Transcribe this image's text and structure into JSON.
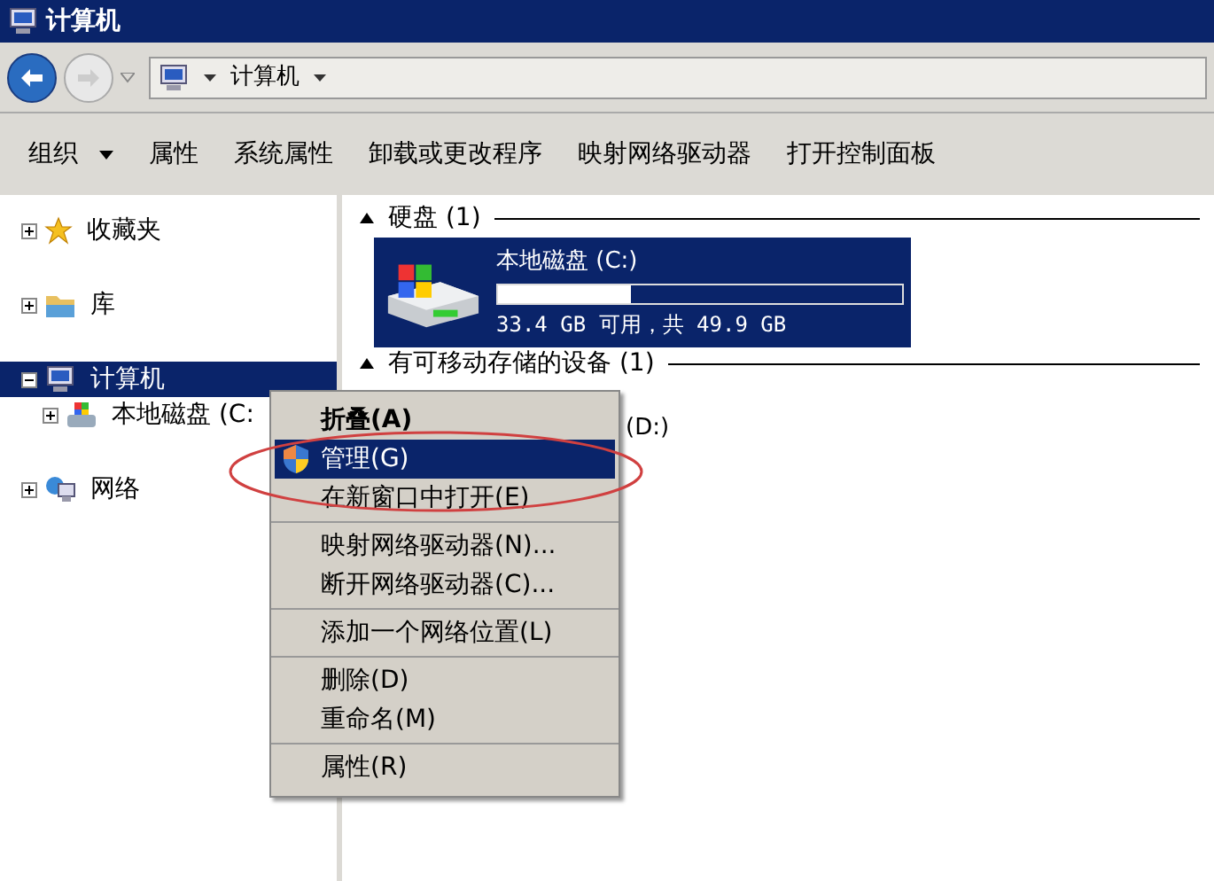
{
  "window": {
    "title": "计算机"
  },
  "address": {
    "path": "计算机"
  },
  "toolbar": [
    {
      "label": "组织",
      "dropdown": true
    },
    {
      "label": "属性",
      "dropdown": false
    },
    {
      "label": "系统属性",
      "dropdown": false
    },
    {
      "label": "卸载或更改程序",
      "dropdown": false
    },
    {
      "label": "映射网络驱动器",
      "dropdown": false
    },
    {
      "label": "打开控制面板",
      "dropdown": false
    }
  ],
  "sidebar": {
    "items": [
      {
        "label": "收藏夹",
        "kind": "star",
        "expanded": false,
        "selected": false
      },
      {
        "label": "库",
        "kind": "library",
        "expanded": false,
        "selected": false
      },
      {
        "label": "计算机",
        "kind": "computer",
        "expanded": true,
        "selected": true,
        "children": [
          {
            "label": "本地磁盘 (C:",
            "kind": "drive",
            "expanded": false,
            "selected": false
          }
        ]
      },
      {
        "label": "网络",
        "kind": "network",
        "expanded": false,
        "selected": false
      }
    ]
  },
  "groups": [
    {
      "title": "硬盘 (1)",
      "expanded": true,
      "drives": [
        {
          "name": "本地磁盘 (C:)",
          "selected": true,
          "level": 0.33,
          "info": "33.4 GB 可用，共 49.9 GB"
        }
      ]
    },
    {
      "title": "有可移动存储的设备 (1)",
      "expanded": true,
      "drives": [
        {
          "name": "(D:)",
          "selected": false
        }
      ]
    }
  ],
  "context_menu": {
    "groups": [
      [
        {
          "label": "折叠(A)",
          "default": true,
          "selected": false,
          "icon": false
        },
        {
          "label": "管理(G)",
          "default": false,
          "selected": true,
          "icon": true
        },
        {
          "label": "在新窗口中打开(E)",
          "default": false,
          "selected": false,
          "icon": false
        }
      ],
      [
        {
          "label": "映射网络驱动器(N)...",
          "default": false,
          "selected": false,
          "icon": false
        },
        {
          "label": "断开网络驱动器(C)...",
          "default": false,
          "selected": false,
          "icon": false
        }
      ],
      [
        {
          "label": "添加一个网络位置(L)",
          "default": false,
          "selected": false,
          "icon": false
        }
      ],
      [
        {
          "label": "删除(D)",
          "default": false,
          "selected": false,
          "icon": false
        },
        {
          "label": "重命名(M)",
          "default": false,
          "selected": false,
          "icon": false
        }
      ],
      [
        {
          "label": "属性(R)",
          "default": false,
          "selected": false,
          "icon": false
        }
      ]
    ]
  }
}
